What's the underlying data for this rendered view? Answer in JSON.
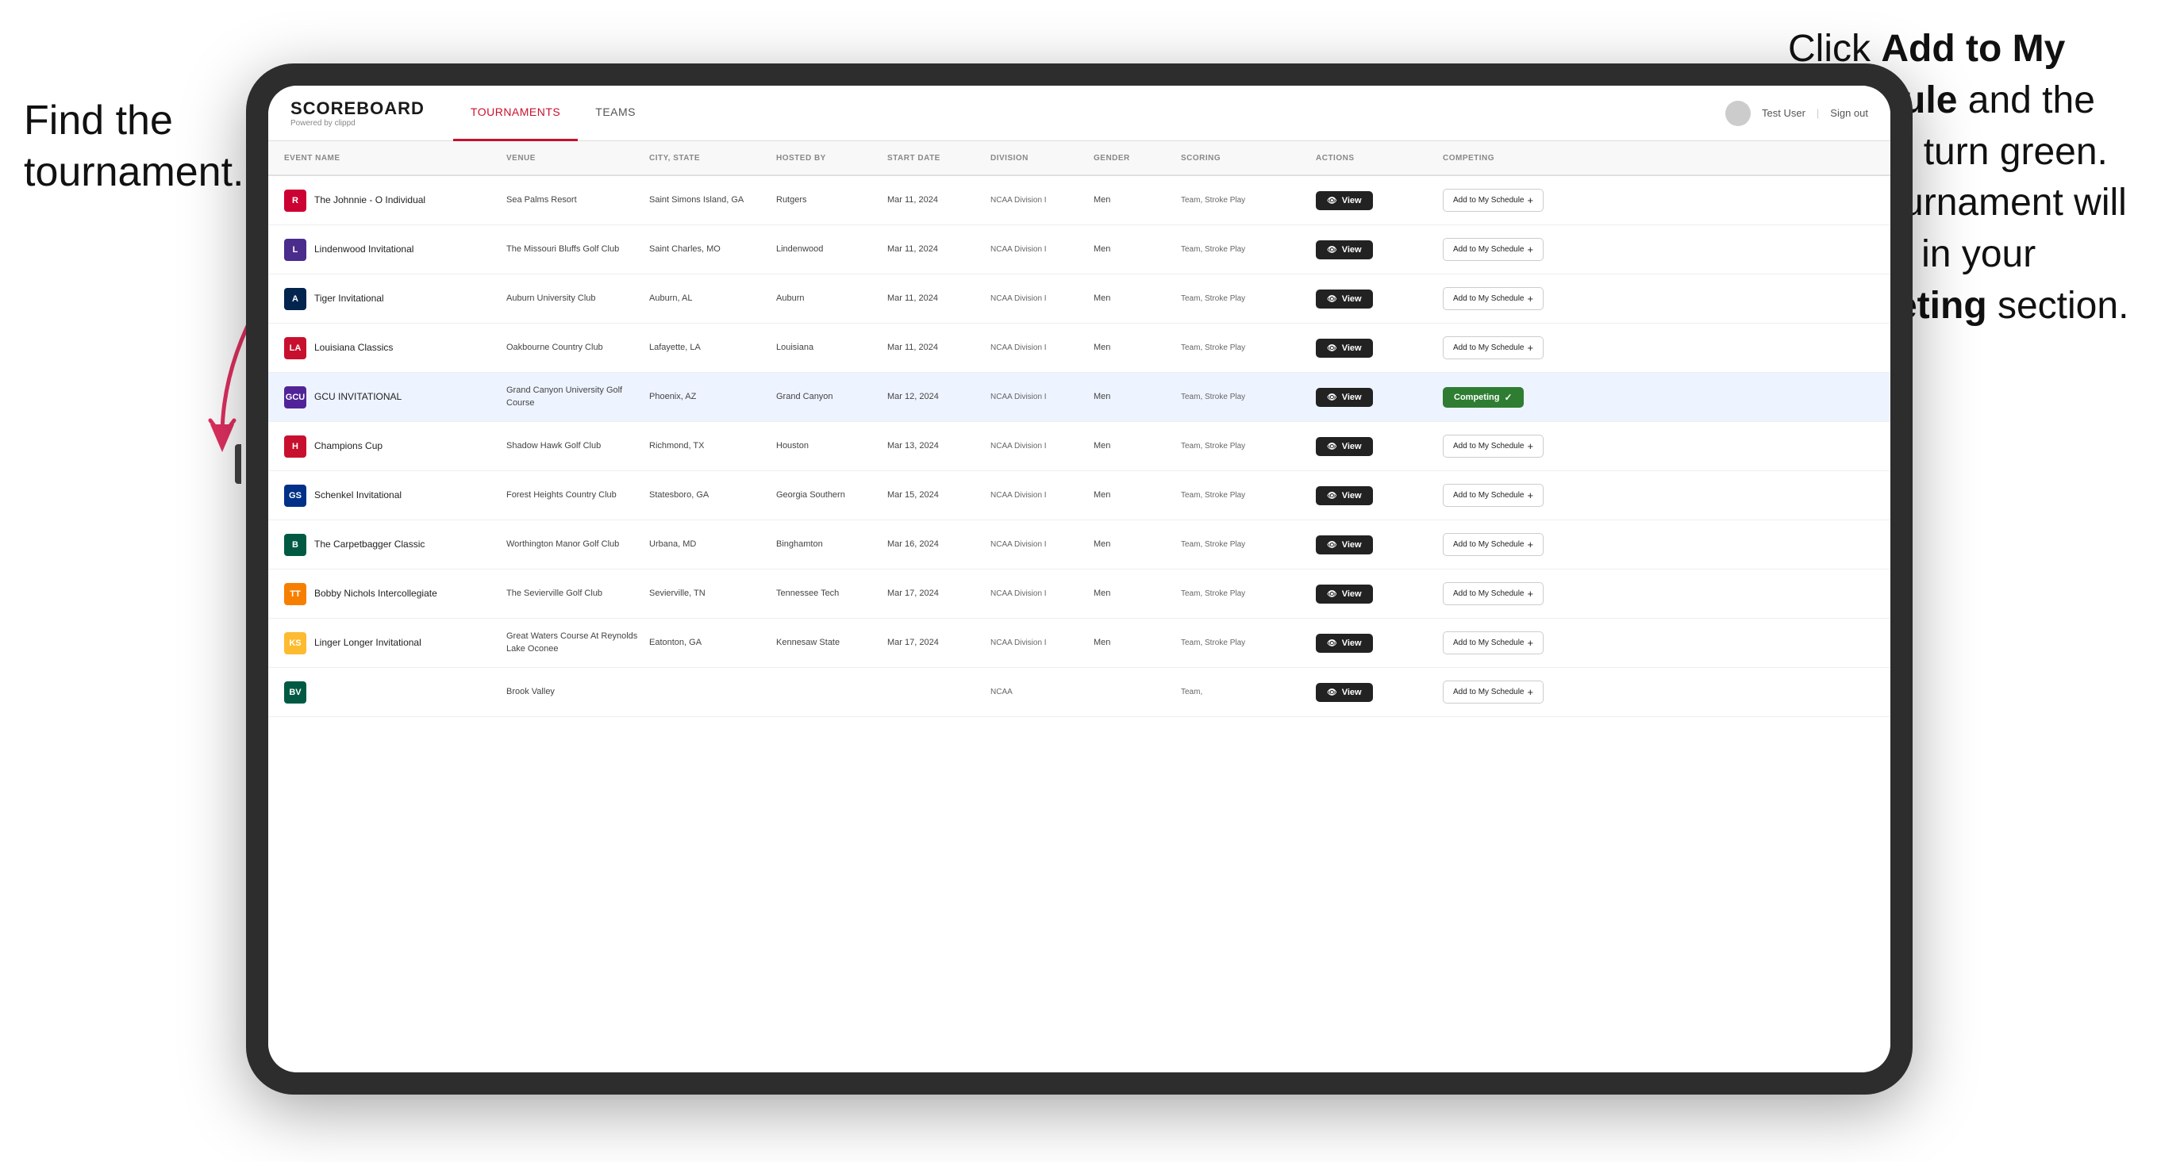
{
  "annotations": {
    "left": "Find the\ntournament.",
    "right_parts": [
      {
        "text": "Click ",
        "bold": false
      },
      {
        "text": "Add to My Schedule",
        "bold": true
      },
      {
        "text": " and the box will turn green. This tournament will now be in your ",
        "bold": false
      },
      {
        "text": "Competing",
        "bold": true
      },
      {
        "text": " section.",
        "bold": false
      }
    ]
  },
  "header": {
    "logo_title": "SCOREBOARD",
    "logo_sub": "Powered by clippd",
    "nav_tabs": [
      "TOURNAMENTS",
      "TEAMS"
    ],
    "active_tab": "TOURNAMENTS",
    "user": "Test User",
    "sign_out": "Sign out"
  },
  "table": {
    "columns": [
      "EVENT NAME",
      "VENUE",
      "CITY, STATE",
      "HOSTED BY",
      "START DATE",
      "DIVISION",
      "GENDER",
      "SCORING",
      "ACTIONS",
      "COMPETING"
    ],
    "rows": [
      {
        "logo_class": "logo-rutgers",
        "logo_text": "R",
        "event_name": "The Johnnie - O Individual",
        "venue": "Sea Palms Resort",
        "city_state": "Saint Simons Island, GA",
        "hosted_by": "Rutgers",
        "start_date": "Mar 11, 2024",
        "division": "NCAA Division I",
        "gender": "Men",
        "scoring": "Team, Stroke Play",
        "action": "view",
        "competing": "add",
        "highlighted": false
      },
      {
        "logo_class": "logo-lindenwood",
        "logo_text": "L",
        "event_name": "Lindenwood Invitational",
        "venue": "The Missouri Bluffs Golf Club",
        "city_state": "Saint Charles, MO",
        "hosted_by": "Lindenwood",
        "start_date": "Mar 11, 2024",
        "division": "NCAA Division I",
        "gender": "Men",
        "scoring": "Team, Stroke Play",
        "action": "view",
        "competing": "add",
        "highlighted": false
      },
      {
        "logo_class": "logo-auburn",
        "logo_text": "A",
        "event_name": "Tiger Invitational",
        "venue": "Auburn University Club",
        "city_state": "Auburn, AL",
        "hosted_by": "Auburn",
        "start_date": "Mar 11, 2024",
        "division": "NCAA Division I",
        "gender": "Men",
        "scoring": "Team, Stroke Play",
        "action": "view",
        "competing": "add",
        "highlighted": false
      },
      {
        "logo_class": "logo-louisiana",
        "logo_text": "LA",
        "event_name": "Louisiana Classics",
        "venue": "Oakbourne Country Club",
        "city_state": "Lafayette, LA",
        "hosted_by": "Louisiana",
        "start_date": "Mar 11, 2024",
        "division": "NCAA Division I",
        "gender": "Men",
        "scoring": "Team, Stroke Play",
        "action": "view",
        "competing": "add",
        "highlighted": false
      },
      {
        "logo_class": "logo-gcu",
        "logo_text": "GCU",
        "event_name": "GCU INVITATIONAL",
        "venue": "Grand Canyon University Golf Course",
        "city_state": "Phoenix, AZ",
        "hosted_by": "Grand Canyon",
        "start_date": "Mar 12, 2024",
        "division": "NCAA Division I",
        "gender": "Men",
        "scoring": "Team, Stroke Play",
        "action": "view",
        "competing": "competing",
        "highlighted": true
      },
      {
        "logo_class": "logo-houston",
        "logo_text": "H",
        "event_name": "Champions Cup",
        "venue": "Shadow Hawk Golf Club",
        "city_state": "Richmond, TX",
        "hosted_by": "Houston",
        "start_date": "Mar 13, 2024",
        "division": "NCAA Division I",
        "gender": "Men",
        "scoring": "Team, Stroke Play",
        "action": "view",
        "competing": "add",
        "highlighted": false
      },
      {
        "logo_class": "logo-georgia-s",
        "logo_text": "GS",
        "event_name": "Schenkel Invitational",
        "venue": "Forest Heights Country Club",
        "city_state": "Statesboro, GA",
        "hosted_by": "Georgia Southern",
        "start_date": "Mar 15, 2024",
        "division": "NCAA Division I",
        "gender": "Men",
        "scoring": "Team, Stroke Play",
        "action": "view",
        "competing": "add",
        "highlighted": false
      },
      {
        "logo_class": "logo-binghamton",
        "logo_text": "B",
        "event_name": "The Carpetbagger Classic",
        "venue": "Worthington Manor Golf Club",
        "city_state": "Urbana, MD",
        "hosted_by": "Binghamton",
        "start_date": "Mar 16, 2024",
        "division": "NCAA Division I",
        "gender": "Men",
        "scoring": "Team, Stroke Play",
        "action": "view",
        "competing": "add",
        "highlighted": false
      },
      {
        "logo_class": "logo-tennessee",
        "logo_text": "TT",
        "event_name": "Bobby Nichols Intercollegiate",
        "venue": "The Sevierville Golf Club",
        "city_state": "Sevierville, TN",
        "hosted_by": "Tennessee Tech",
        "start_date": "Mar 17, 2024",
        "division": "NCAA Division I",
        "gender": "Men",
        "scoring": "Team, Stroke Play",
        "action": "view",
        "competing": "add",
        "highlighted": false
      },
      {
        "logo_class": "logo-kennesaw",
        "logo_text": "KS",
        "event_name": "Linger Longer Invitational",
        "venue": "Great Waters Course At Reynolds Lake Oconee",
        "city_state": "Eatonton, GA",
        "hosted_by": "Kennesaw State",
        "start_date": "Mar 17, 2024",
        "division": "NCAA Division I",
        "gender": "Men",
        "scoring": "Team, Stroke Play",
        "action": "view",
        "competing": "add",
        "highlighted": false
      },
      {
        "logo_class": "logo-binghamton",
        "logo_text": "BV",
        "event_name": "",
        "venue": "Brook Valley",
        "city_state": "",
        "hosted_by": "",
        "start_date": "",
        "division": "NCAA",
        "gender": "",
        "scoring": "Team,",
        "action": "view",
        "competing": "add",
        "highlighted": false
      }
    ],
    "btn_view": "View",
    "btn_add": "Add to My Schedule",
    "btn_competing": "Competing"
  }
}
